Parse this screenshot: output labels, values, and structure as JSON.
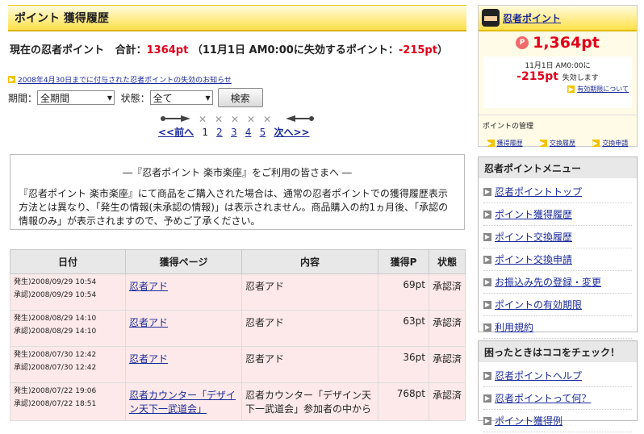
{
  "page": {
    "title": "ポイント 獲得履歴",
    "summary": {
      "current_label": "現在の忍者ポイント",
      "total_label": "合計：",
      "total_value": "1364pt",
      "expire_prefix": "（11月1日",
      "expire_time": "AM0:00",
      "expire_suffix": "に失効するポイント：",
      "expire_value": "-215pt",
      "close": "）"
    },
    "notice_link": "2008年4月30日までに付与された忍者ポイントの失効のお知らせ"
  },
  "filter": {
    "period_label": "期間：",
    "period_value": "全期間",
    "status_label": "状態：",
    "status_value": "全て",
    "search_button": "検索"
  },
  "pager": {
    "prev": "<<前へ",
    "pages": [
      "1",
      "2",
      "3",
      "4",
      "5"
    ],
    "next": "次へ>>"
  },
  "info": {
    "heading": "―『忍者ポイント 楽市楽座』をご利用の皆さまへ ―",
    "body": "『忍者ポイント 楽市楽座』にて商品をご購入された場合は、通常の忍者ポイントでの獲得履歴表示方法とは異なり、「発生の情報(未承認の情報)」は表示されません。商品購入の約1ヵ月後、「承認の情報のみ」が表示されますので、予めご了承ください。"
  },
  "table": {
    "headers": [
      "日付",
      "獲得ページ",
      "内容",
      "獲得P",
      "状態"
    ],
    "rows": [
      {
        "issued": "発生)2008/09/29 10:54",
        "approved": "承認)2008/09/29 10:54",
        "page": "忍者アド",
        "content": "忍者アド",
        "points": "69pt",
        "status": "承認済"
      },
      {
        "issued": "発生)2008/08/29 14:10",
        "approved": "承認)2008/08/29 14:10",
        "page": "忍者アド",
        "content": "忍者アド",
        "points": "63pt",
        "status": "承認済"
      },
      {
        "issued": "発生)2008/07/30 12:42",
        "approved": "承認)2008/07/30 12:42",
        "page": "忍者アド",
        "content": "忍者アド",
        "points": "36pt",
        "status": "承認済"
      },
      {
        "issued": "発生)2008/07/22 19:06",
        "approved": "承認)2008/07/22 18:51",
        "page": "忍者カウンター「デザイン天下一武道会」",
        "content": "忍者カウンター「デザイン天下一武道会」参加者の中から",
        "points": "768pt",
        "status": "承認済"
      }
    ]
  },
  "sidebar": {
    "points_title": "忍者ポイント",
    "points_value": "1,364pt",
    "expire_date": "11月1日 AM0:00に",
    "expire_value": "-215pt",
    "expire_suffix": "失効します",
    "validity_link": "有効期限について",
    "mgmt_label": "ポイントの管理",
    "mgmt_links": [
      "獲得履歴",
      "交換履歴",
      "交換申請"
    ],
    "menu_title": "忍者ポイントメニュー",
    "menu_items": [
      "忍者ポイントトップ",
      "ポイント獲得履歴",
      "ポイント交換履歴",
      "ポイント交換申請",
      "お振込み先の登録・変更",
      "ポイントの有効期限",
      "利用規約"
    ],
    "help_title": "困ったときはココをチェック！",
    "help_items": [
      "忍者ポイントヘルプ",
      "忍者ポイントって何？",
      "ポイント獲得例"
    ]
  },
  "colors": {
    "accent_yellow": "#ffe14a",
    "point_red": "#e0001a",
    "row_pink": "#fde9e9",
    "link_blue": "#1a2a9a"
  }
}
